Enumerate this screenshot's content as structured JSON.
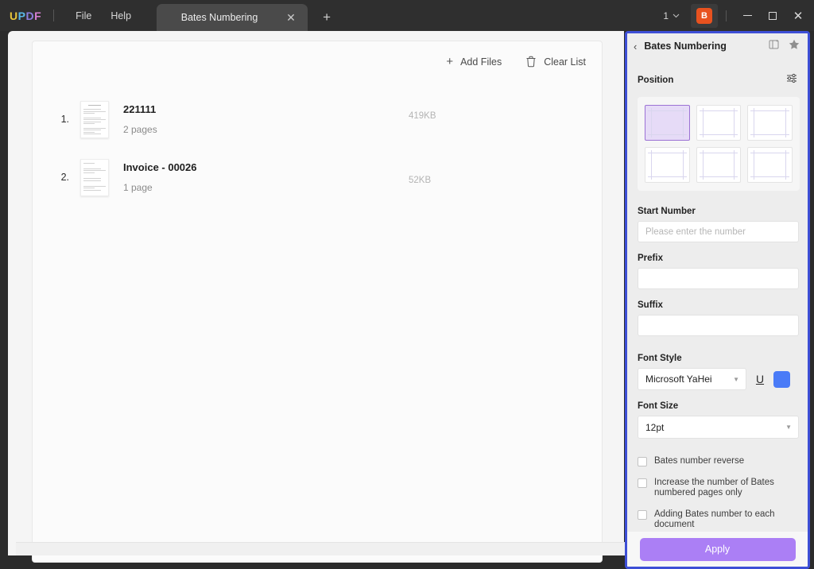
{
  "titlebar": {
    "logo": [
      "U",
      "P",
      "D",
      "F"
    ],
    "menus": [
      {
        "label": "File",
        "name": "menu-file"
      },
      {
        "label": "Help",
        "name": "menu-help"
      }
    ],
    "tab": {
      "label": "Bates Numbering",
      "close_icon": "✕"
    },
    "new_tab_icon": "+",
    "window_count": "1",
    "chevron_icon": "⌄",
    "avatar_initial": "B",
    "window_controls": {
      "minimize": "minimize-icon",
      "maximize": "maximize-icon",
      "close": "✕"
    }
  },
  "workspace": {
    "toolbar": {
      "add_files_label": "Add Files",
      "add_files_icon": "+",
      "clear_list_label": "Clear List",
      "clear_list_icon": "trash-icon"
    },
    "files": [
      {
        "index": "1.",
        "name": "221111",
        "pages": "2 pages",
        "size": "419KB"
      },
      {
        "index": "2.",
        "name": "Invoice - 00026",
        "pages": "1 page",
        "size": "52KB"
      }
    ]
  },
  "panel": {
    "back_icon": "‹",
    "title": "Bates Numbering",
    "head_icons": [
      "panel-layout-icon",
      "star-icon"
    ],
    "position": {
      "label": "Position",
      "settings_icon": "sliders-icon",
      "cells": [
        {
          "name": "position-cell-top-left",
          "selected": true
        },
        {
          "name": "position-cell-top-center",
          "selected": false
        },
        {
          "name": "position-cell-top-right",
          "selected": false
        },
        {
          "name": "position-cell-bottom-left",
          "selected": false
        },
        {
          "name": "position-cell-bottom-center",
          "selected": false
        },
        {
          "name": "position-cell-bottom-right",
          "selected": false
        }
      ]
    },
    "start_number": {
      "label": "Start Number",
      "value": "",
      "placeholder": "Please enter the number"
    },
    "prefix": {
      "label": "Prefix",
      "value": "",
      "placeholder": ""
    },
    "suffix": {
      "label": "Suffix",
      "value": "",
      "placeholder": ""
    },
    "font_style": {
      "label": "Font Style",
      "value": "Microsoft YaHei",
      "caret": "▼",
      "underline_label": "U",
      "color": "#4a7bf7"
    },
    "font_size": {
      "label": "Font Size",
      "value": "12pt",
      "caret": "▼"
    },
    "checkboxes": [
      {
        "label": "Bates number reverse",
        "name": "checkbox-bates-number-reverse",
        "checked": false
      },
      {
        "label": "Increase the number of Bates numbered pages only",
        "name": "checkbox-increase-number-numbered-pages-only",
        "checked": false
      },
      {
        "label": "Adding Bates number to each document",
        "name": "checkbox-adding-bates-number-each-document",
        "checked": false
      }
    ],
    "apply_label": "Apply",
    "accent_border": "#3d4fd6",
    "apply_color": "#ab7ff5"
  }
}
